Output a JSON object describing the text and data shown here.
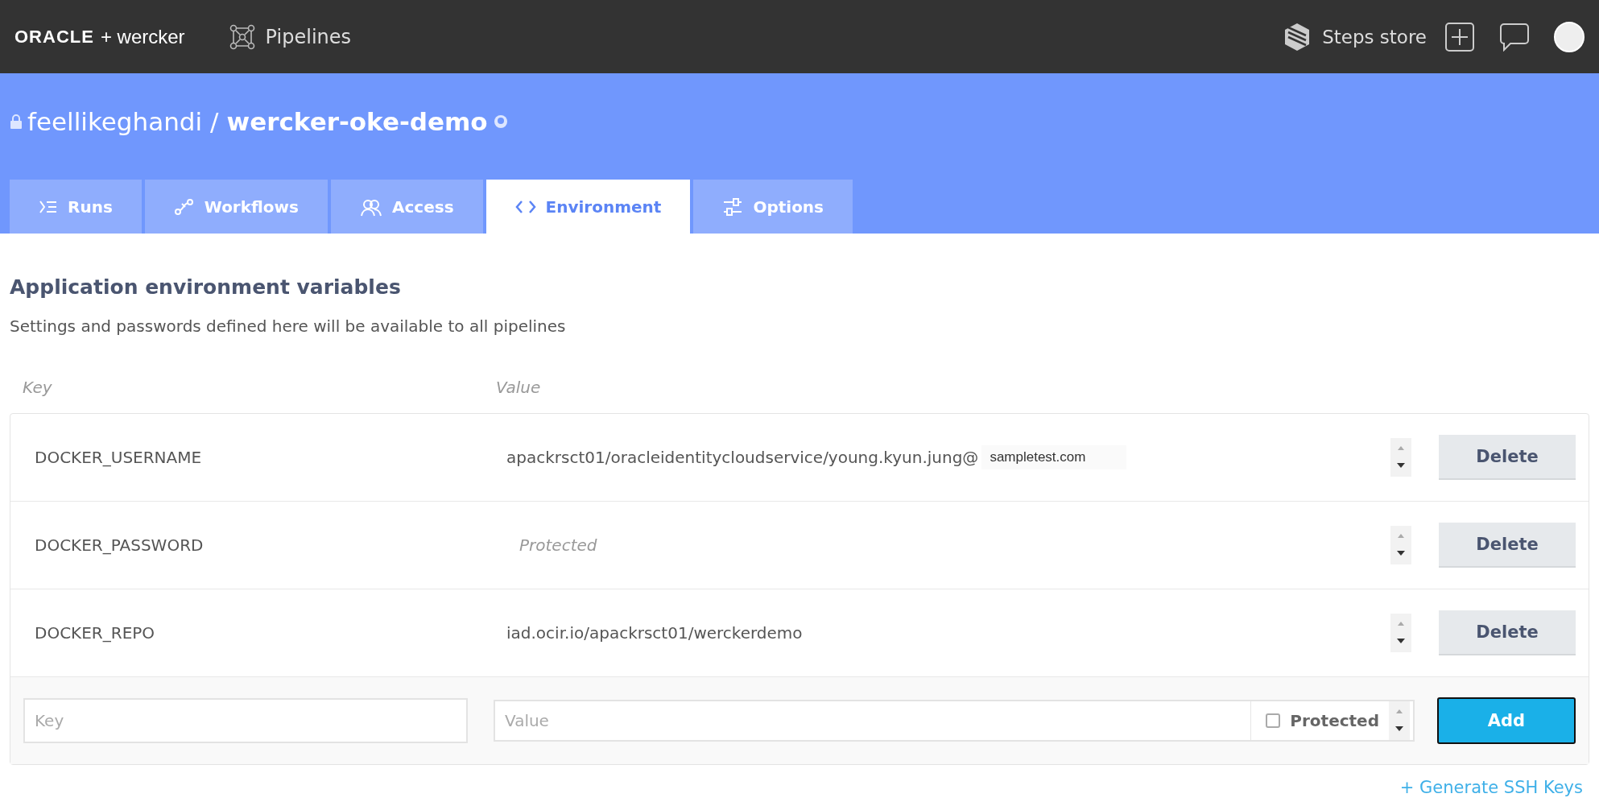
{
  "topbar": {
    "brand": "ORACLE",
    "brand_suffix": "+ wercker",
    "nav": "Pipelines",
    "steps_store": "Steps store"
  },
  "project": {
    "private": true,
    "owner": "feellikeghandi",
    "separator": "/",
    "name": "wercker-oke-demo"
  },
  "tabs": [
    {
      "label": "Runs",
      "selected": false
    },
    {
      "label": "Workflows",
      "selected": false
    },
    {
      "label": "Access",
      "selected": false
    },
    {
      "label": "Environment",
      "selected": true
    },
    {
      "label": "Options",
      "selected": false
    }
  ],
  "section": {
    "title": "Application environment variables",
    "description": "Settings and passwords defined here will be available to all pipelines"
  },
  "table": {
    "columns": [
      "Key",
      "Value"
    ],
    "rows": [
      {
        "key": "DOCKER_USERNAME",
        "value": "apackrsct01/oracleidentitycloudservice/young.kyun.jung@",
        "overlay": "sampletest.com",
        "protected": false,
        "action": "Delete"
      },
      {
        "key": "DOCKER_PASSWORD",
        "value": "Protected",
        "protected": true,
        "action": "Delete"
      },
      {
        "key": "DOCKER_REPO",
        "value": "iad.ocir.io/apackrsct01/werckerdemo",
        "protected": false,
        "action": "Delete"
      }
    ],
    "new_row": {
      "key_placeholder": "Key",
      "value_placeholder": "Value",
      "protected_label": "Protected",
      "checked": false,
      "action": "Add"
    }
  },
  "generate_link": "+ Generate SSH Keys"
}
